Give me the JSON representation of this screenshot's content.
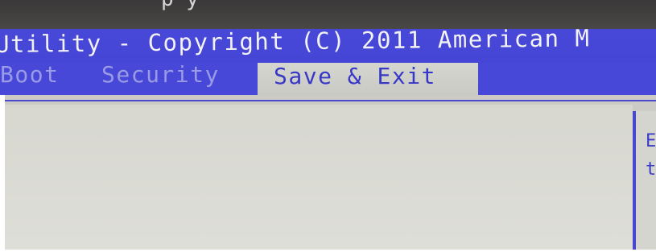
{
  "window": {
    "title": "Utility - Copyright (C) 2011 American M",
    "top_fragment": "p                         y"
  },
  "tabs": [
    {
      "label": "Boot",
      "display": "Boot",
      "active": false
    },
    {
      "label": "Security",
      "display": "Security",
      "active": false
    },
    {
      "label": "Save & Exit",
      "display": "Save & Exit",
      "active": true
    }
  ],
  "help_panel": {
    "line1": "E",
    "line2": "t"
  },
  "colors": {
    "title_bar": "#4848d8",
    "active_tab_bg": "#cacac4",
    "active_tab_text": "#3838c8",
    "inactive_tab_text": "#9a9ae6",
    "body_bg": "#d7d7d0"
  }
}
